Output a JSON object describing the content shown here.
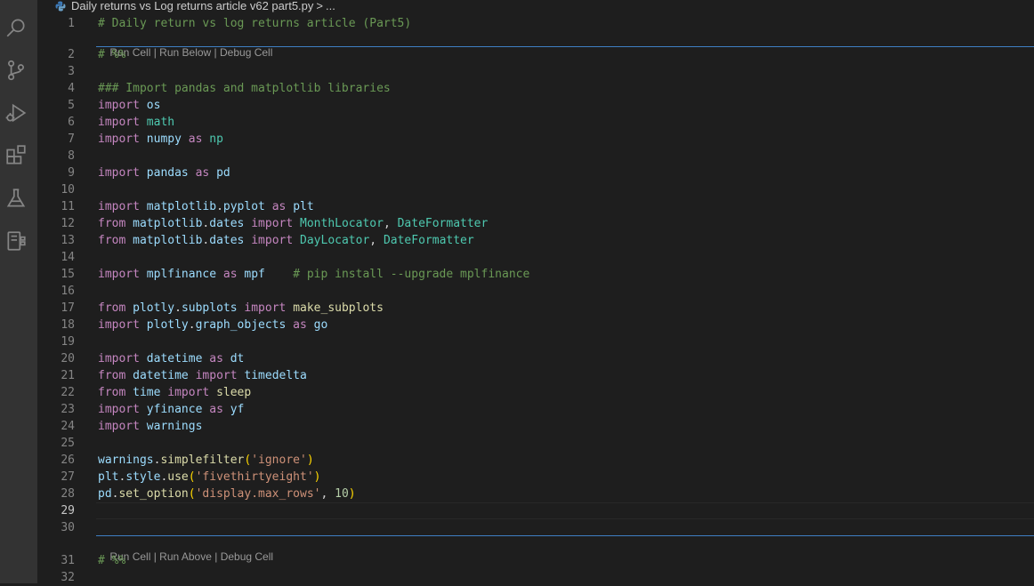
{
  "activity_bar": {
    "icons": [
      "search-icon",
      "source-control-icon",
      "run-debug-icon",
      "extensions-icon",
      "testing-icon",
      "jupyter-icon"
    ]
  },
  "breadcrumb": {
    "file_name": "Daily returns vs Log returns article v62 part5.py",
    "separator": ">",
    "ellipsis": "..."
  },
  "codelens": {
    "top": {
      "run_cell": "Run Cell",
      "sep1": " | ",
      "run_below": "Run Below",
      "sep2": " | ",
      "debug_cell": "Debug Cell"
    },
    "bottom": {
      "run_cell": "Run Cell",
      "sep1": " | ",
      "run_above": "Run Above",
      "sep2": " | ",
      "debug_cell": "Debug Cell"
    }
  },
  "editor": {
    "active_line": "29",
    "lines": [
      {
        "n": "1",
        "tokens": [
          {
            "t": "# Daily return vs log returns article (Part5)",
            "c": "cm"
          }
        ]
      },
      {
        "n": "2",
        "tokens": [
          {
            "t": "# %%",
            "c": "cm"
          }
        ]
      },
      {
        "n": "3",
        "tokens": []
      },
      {
        "n": "4",
        "tokens": [
          {
            "t": "### Import pandas and matplotlib libraries",
            "c": "cm"
          }
        ]
      },
      {
        "n": "5",
        "tokens": [
          {
            "t": "import",
            "c": "kw"
          },
          {
            "t": " ",
            "c": "pn"
          },
          {
            "t": "os",
            "c": "nm"
          }
        ]
      },
      {
        "n": "6",
        "tokens": [
          {
            "t": "import",
            "c": "kw"
          },
          {
            "t": " ",
            "c": "pn"
          },
          {
            "t": "math",
            "c": "md"
          }
        ]
      },
      {
        "n": "7",
        "tokens": [
          {
            "t": "import",
            "c": "kw"
          },
          {
            "t": " ",
            "c": "pn"
          },
          {
            "t": "numpy",
            "c": "nm"
          },
          {
            "t": " ",
            "c": "pn"
          },
          {
            "t": "as",
            "c": "kw"
          },
          {
            "t": " ",
            "c": "pn"
          },
          {
            "t": "np",
            "c": "md"
          }
        ]
      },
      {
        "n": "8",
        "tokens": []
      },
      {
        "n": "9",
        "tokens": [
          {
            "t": "import",
            "c": "kw"
          },
          {
            "t": " ",
            "c": "pn"
          },
          {
            "t": "pandas",
            "c": "nm"
          },
          {
            "t": " ",
            "c": "pn"
          },
          {
            "t": "as",
            "c": "kw"
          },
          {
            "t": " ",
            "c": "pn"
          },
          {
            "t": "pd",
            "c": "nm"
          }
        ]
      },
      {
        "n": "10",
        "tokens": []
      },
      {
        "n": "11",
        "tokens": [
          {
            "t": "import",
            "c": "kw"
          },
          {
            "t": " ",
            "c": "pn"
          },
          {
            "t": "matplotlib",
            "c": "nm"
          },
          {
            "t": ".",
            "c": "pn"
          },
          {
            "t": "pyplot",
            "c": "nm"
          },
          {
            "t": " ",
            "c": "pn"
          },
          {
            "t": "as",
            "c": "kw"
          },
          {
            "t": " ",
            "c": "pn"
          },
          {
            "t": "plt",
            "c": "nm"
          }
        ]
      },
      {
        "n": "12",
        "tokens": [
          {
            "t": "from",
            "c": "kw"
          },
          {
            "t": " ",
            "c": "pn"
          },
          {
            "t": "matplotlib",
            "c": "nm"
          },
          {
            "t": ".",
            "c": "pn"
          },
          {
            "t": "dates",
            "c": "nm"
          },
          {
            "t": " ",
            "c": "pn"
          },
          {
            "t": "import",
            "c": "kw"
          },
          {
            "t": " ",
            "c": "pn"
          },
          {
            "t": "MonthLocator",
            "c": "cls"
          },
          {
            "t": ", ",
            "c": "pn"
          },
          {
            "t": "DateFormatter",
            "c": "cls"
          }
        ]
      },
      {
        "n": "13",
        "tokens": [
          {
            "t": "from",
            "c": "kw"
          },
          {
            "t": " ",
            "c": "pn"
          },
          {
            "t": "matplotlib",
            "c": "nm"
          },
          {
            "t": ".",
            "c": "pn"
          },
          {
            "t": "dates",
            "c": "nm"
          },
          {
            "t": " ",
            "c": "pn"
          },
          {
            "t": "import",
            "c": "kw"
          },
          {
            "t": " ",
            "c": "pn"
          },
          {
            "t": "DayLocator",
            "c": "cls"
          },
          {
            "t": ", ",
            "c": "pn"
          },
          {
            "t": "DateFormatter",
            "c": "cls"
          }
        ]
      },
      {
        "n": "14",
        "tokens": []
      },
      {
        "n": "15",
        "tokens": [
          {
            "t": "import",
            "c": "kw"
          },
          {
            "t": " ",
            "c": "pn"
          },
          {
            "t": "mplfinance",
            "c": "nm"
          },
          {
            "t": " ",
            "c": "pn"
          },
          {
            "t": "as",
            "c": "kw"
          },
          {
            "t": " ",
            "c": "pn"
          },
          {
            "t": "mpf",
            "c": "nm"
          },
          {
            "t": "    ",
            "c": "pn"
          },
          {
            "t": "# pip install --upgrade mplfinance",
            "c": "cm"
          }
        ]
      },
      {
        "n": "16",
        "tokens": []
      },
      {
        "n": "17",
        "tokens": [
          {
            "t": "from",
            "c": "kw"
          },
          {
            "t": " ",
            "c": "pn"
          },
          {
            "t": "plotly",
            "c": "nm"
          },
          {
            "t": ".",
            "c": "pn"
          },
          {
            "t": "subplots",
            "c": "nm"
          },
          {
            "t": " ",
            "c": "pn"
          },
          {
            "t": "import",
            "c": "kw"
          },
          {
            "t": " ",
            "c": "pn"
          },
          {
            "t": "make_subplots",
            "c": "fn"
          }
        ]
      },
      {
        "n": "18",
        "tokens": [
          {
            "t": "import",
            "c": "kw"
          },
          {
            "t": " ",
            "c": "pn"
          },
          {
            "t": "plotly",
            "c": "nm"
          },
          {
            "t": ".",
            "c": "pn"
          },
          {
            "t": "graph_objects",
            "c": "nm"
          },
          {
            "t": " ",
            "c": "pn"
          },
          {
            "t": "as",
            "c": "kw"
          },
          {
            "t": " ",
            "c": "pn"
          },
          {
            "t": "go",
            "c": "nm"
          }
        ]
      },
      {
        "n": "19",
        "tokens": []
      },
      {
        "n": "20",
        "tokens": [
          {
            "t": "import",
            "c": "kw"
          },
          {
            "t": " ",
            "c": "pn"
          },
          {
            "t": "datetime",
            "c": "nm"
          },
          {
            "t": " ",
            "c": "pn"
          },
          {
            "t": "as",
            "c": "kw"
          },
          {
            "t": " ",
            "c": "pn"
          },
          {
            "t": "dt",
            "c": "nm"
          }
        ]
      },
      {
        "n": "21",
        "tokens": [
          {
            "t": "from",
            "c": "kw"
          },
          {
            "t": " ",
            "c": "pn"
          },
          {
            "t": "datetime",
            "c": "nm"
          },
          {
            "t": " ",
            "c": "pn"
          },
          {
            "t": "import",
            "c": "kw"
          },
          {
            "t": " ",
            "c": "pn"
          },
          {
            "t": "timedelta",
            "c": "nm"
          }
        ]
      },
      {
        "n": "22",
        "tokens": [
          {
            "t": "from",
            "c": "kw"
          },
          {
            "t": " ",
            "c": "pn"
          },
          {
            "t": "time",
            "c": "nm"
          },
          {
            "t": " ",
            "c": "pn"
          },
          {
            "t": "import",
            "c": "kw"
          },
          {
            "t": " ",
            "c": "pn"
          },
          {
            "t": "sleep",
            "c": "fn"
          }
        ]
      },
      {
        "n": "23",
        "tokens": [
          {
            "t": "import",
            "c": "kw"
          },
          {
            "t": " ",
            "c": "pn"
          },
          {
            "t": "yfinance",
            "c": "nm"
          },
          {
            "t": " ",
            "c": "pn"
          },
          {
            "t": "as",
            "c": "kw"
          },
          {
            "t": " ",
            "c": "pn"
          },
          {
            "t": "yf",
            "c": "nm"
          }
        ]
      },
      {
        "n": "24",
        "tokens": [
          {
            "t": "import",
            "c": "kw"
          },
          {
            "t": " ",
            "c": "pn"
          },
          {
            "t": "warnings",
            "c": "nm"
          }
        ]
      },
      {
        "n": "25",
        "tokens": []
      },
      {
        "n": "26",
        "tokens": [
          {
            "t": "warnings",
            "c": "nm"
          },
          {
            "t": ".",
            "c": "pn"
          },
          {
            "t": "simplefilter",
            "c": "fn"
          },
          {
            "t": "(",
            "c": "br"
          },
          {
            "t": "'ignore'",
            "c": "str"
          },
          {
            "t": ")",
            "c": "br"
          }
        ]
      },
      {
        "n": "27",
        "tokens": [
          {
            "t": "plt",
            "c": "nm"
          },
          {
            "t": ".",
            "c": "pn"
          },
          {
            "t": "style",
            "c": "nm"
          },
          {
            "t": ".",
            "c": "pn"
          },
          {
            "t": "use",
            "c": "fn"
          },
          {
            "t": "(",
            "c": "br"
          },
          {
            "t": "'fivethirtyeight'",
            "c": "str"
          },
          {
            "t": ")",
            "c": "br"
          }
        ]
      },
      {
        "n": "28",
        "tokens": [
          {
            "t": "pd",
            "c": "nm"
          },
          {
            "t": ".",
            "c": "pn"
          },
          {
            "t": "set_option",
            "c": "fn"
          },
          {
            "t": "(",
            "c": "br"
          },
          {
            "t": "'display.max_rows'",
            "c": "str"
          },
          {
            "t": ", ",
            "c": "pn"
          },
          {
            "t": "10",
            "c": "num"
          },
          {
            "t": ")",
            "c": "br"
          }
        ]
      },
      {
        "n": "29",
        "tokens": []
      },
      {
        "n": "30",
        "tokens": []
      },
      {
        "n": "31",
        "tokens": [
          {
            "t": "# %%",
            "c": "cm"
          }
        ]
      },
      {
        "n": "32",
        "tokens": []
      }
    ]
  }
}
